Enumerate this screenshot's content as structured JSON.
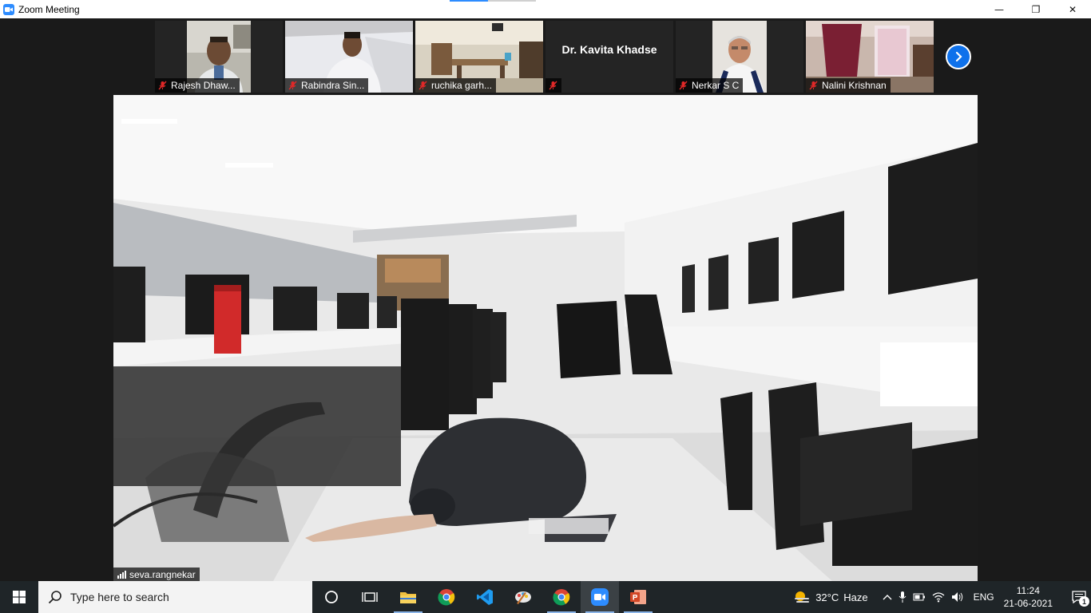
{
  "window": {
    "title": "Zoom Meeting",
    "controls": {
      "minimize": "—",
      "maximize": "❐",
      "close": "✕"
    }
  },
  "participants": [
    {
      "name": "Rajesh Dhaw...",
      "muted": true,
      "has_video": true
    },
    {
      "name": "Rabindra Sin...",
      "muted": true,
      "has_video": true
    },
    {
      "name": "ruchika garh...",
      "muted": true,
      "has_video": true
    },
    {
      "name": "",
      "display_name": "Dr. Kavita Khadse",
      "muted": true,
      "has_video": false
    },
    {
      "name": "Nerkar S C",
      "muted": true,
      "has_video": true
    },
    {
      "name": "Nalini Krishnan",
      "muted": true,
      "has_video": true
    }
  ],
  "active_speaker": {
    "name": "seva.rangnekar"
  },
  "taskbar": {
    "search_placeholder": "Type here to search",
    "apps": [
      "task-view",
      "file-explorer",
      "chrome",
      "vscode",
      "paint",
      "chrome",
      "zoom",
      "powerpoint"
    ],
    "weather": {
      "temp": "32°C",
      "condition": "Haze"
    },
    "language": "ENG",
    "time": "11:24",
    "date": "21-06-2021",
    "notification_count": "1"
  },
  "colors": {
    "accent": "#2d8cff",
    "muted_red": "#e02828",
    "taskbar": "#1f2528"
  }
}
